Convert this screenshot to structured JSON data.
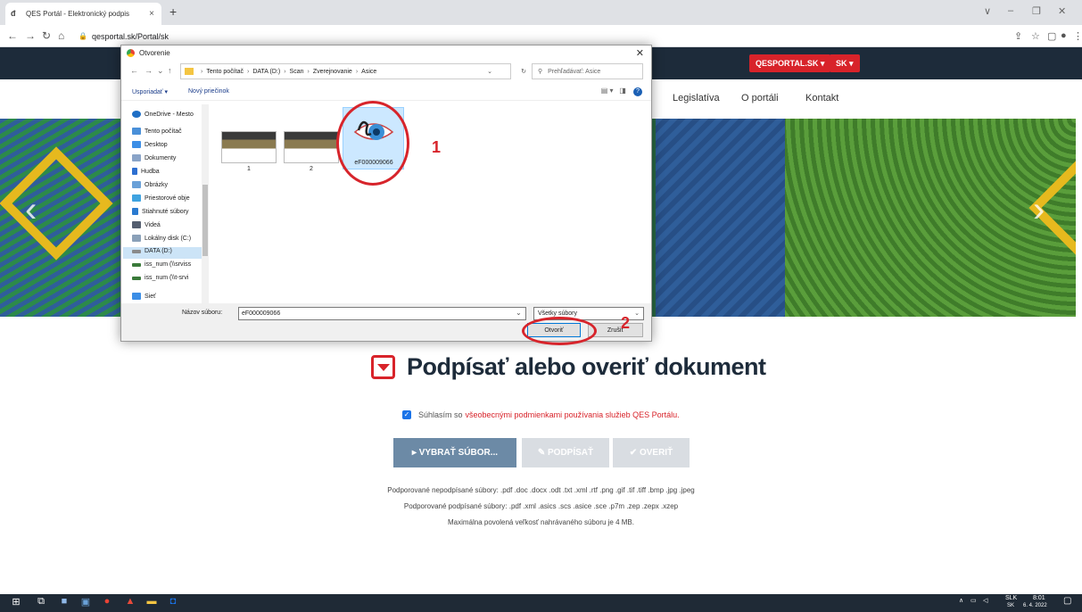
{
  "browser": {
    "tab_title": "QES Portál - Elektronický podpis",
    "tab_close": "×",
    "new_tab": "+",
    "url": "qesportal.sk/Portal/sk",
    "window_controls": [
      "∨",
      "–",
      "❐",
      "✕"
    ]
  },
  "site": {
    "qesportal_button": "QESPORTAL.SK ▾",
    "lang_button": "SK ▾",
    "nav": [
      "Legislatíva",
      "O portáli",
      "Kontakt"
    ]
  },
  "main": {
    "title": "Podpísať alebo overiť dokument",
    "agree_text": "Súhlasím so",
    "agree_link": "všeobecnými podmienkami používania služieb QES Portálu.",
    "btn_choose": "▸ VYBRAŤ SÚBOR...",
    "btn_sign": "✎ PODPÍSAŤ",
    "btn_verify": "✔ OVERIŤ",
    "supported_unsigned": "Podporované nepodpísané súbory: .pdf .doc .docx .odt .txt .xml .rtf .png .gif .tif .tiff .bmp .jpg .jpeg",
    "supported_signed": "Podporované podpísané súbory: .pdf .xml .asics .scs .asice .sce .p7m .zep .zepx .xzep",
    "max_size": "Maximálna povolená veľkosť nahrávaného súboru je 4 MB."
  },
  "dialog": {
    "title": "Otvorenie",
    "path": [
      "Tento počítač",
      "DATA (D:)",
      "Scan",
      "Zverejnovanie",
      "Asice"
    ],
    "search_placeholder": "Prehľadávať: Asice",
    "organize": "Usporiadať ▾",
    "new_folder": "Nový priečinok",
    "nav_items": [
      {
        "label": "OneDrive - Mesto",
        "color": "#1f6fc5"
      },
      {
        "label": "Tento počítač",
        "color": "#4a90d9"
      },
      {
        "label": "Desktop",
        "color": "#3c8ee6"
      },
      {
        "label": "Dokumenty",
        "color": "#8aa4c8"
      },
      {
        "label": "Hudba",
        "color": "#2d6fd1"
      },
      {
        "label": "Obrázky",
        "color": "#6aa1d8"
      },
      {
        "label": "Priestorové obje",
        "color": "#3fa3e0"
      },
      {
        "label": "Stiahnuté súbory",
        "color": "#2a7ad0"
      },
      {
        "label": "Videá",
        "color": "#555f70"
      },
      {
        "label": "Lokálny disk (C:)",
        "color": "#8aa0b8"
      },
      {
        "label": "DATA (D:)",
        "color": "#8a8a8a"
      },
      {
        "label": "iss_num (\\\\srviss",
        "color": "#3a7a3a"
      },
      {
        "label": "iss_num (\\\\t-srvi",
        "color": "#3a7a3a"
      },
      {
        "label": "Sieť",
        "color": "#3c8ee6"
      }
    ],
    "files": [
      {
        "label": "1"
      },
      {
        "label": "2"
      },
      {
        "label": "eF000009066"
      }
    ],
    "file_name_label": "Názov súboru:",
    "file_name_value": "eF000009066",
    "file_type": "Všetky súbory",
    "open_button": "Otvoriť",
    "cancel_button": "Zrušiť",
    "close": "✕"
  },
  "annotations": {
    "label1": "1",
    "label2": "2",
    "color": "#d7242b"
  },
  "taskbar": {
    "lang": "SLK",
    "lang2": "SK",
    "time": "8:01",
    "date": "6. 4. 2022"
  }
}
